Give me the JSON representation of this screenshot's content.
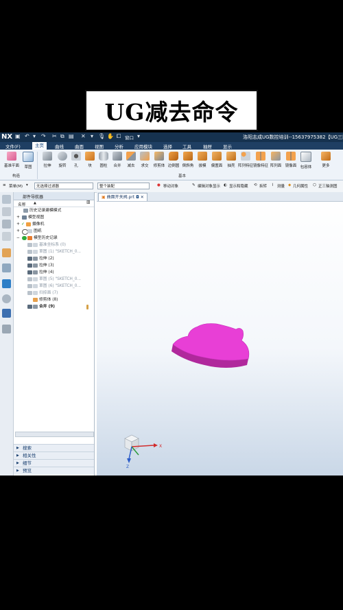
{
  "banner": {
    "title": "UG减去命令"
  },
  "titlebar": {
    "logo": "NX",
    "window_menu": "窗口",
    "title": "洛阳志成UG数控培训--15637975382【UG三四五"
  },
  "menubar": {
    "items": [
      "文件(F)",
      "主页",
      "曲线",
      "曲面",
      "视图",
      "分析",
      "应用模块",
      "选择",
      "工具",
      "抽屉",
      "显示"
    ],
    "active": "主页"
  },
  "ribbon": {
    "buttons": [
      "基准平面",
      "草图",
      "拉伸",
      "旋转",
      "孔",
      "块",
      "圆柱",
      "合并",
      "减去",
      "求交",
      "修剪体",
      "边倒圆",
      "倒斜角",
      "拔模",
      "偏置面",
      "抽壳",
      "阵列特征",
      "镜像特征",
      "阵列面",
      "镜像面",
      "包容体",
      "更多"
    ],
    "groups": [
      "构造",
      "基本"
    ]
  },
  "filterbar": {
    "menu_label": "菜单(M)",
    "filter_placeholder": "无选择过滤器",
    "scope": "整个装配",
    "tools": [
      "移动对象",
      "编辑对象显示",
      "显示和隐藏",
      "拆转",
      "测量",
      "几何属性",
      "正三轴测图"
    ]
  },
  "navigator": {
    "title": "部件导航器",
    "column_name": "名称",
    "rows": [
      {
        "label": "历史记录建模模式",
        "indent": 1,
        "dim": false
      },
      {
        "label": "模型视图",
        "indent": 0,
        "dim": false
      },
      {
        "label": "摄像机",
        "indent": 0,
        "dim": false
      },
      {
        "label": "图纸",
        "indent": 0,
        "dim": false
      },
      {
        "label": "模型历史记录",
        "indent": 0,
        "dim": false
      },
      {
        "label": "基准坐标系 (0)",
        "indent": 1,
        "dim": true
      },
      {
        "label": "草图 (1) \"SKETCH_0...",
        "indent": 1,
        "dim": true
      },
      {
        "label": "拉伸 (2)",
        "indent": 1,
        "dim": false
      },
      {
        "label": "拉伸 (3)",
        "indent": 1,
        "dim": false
      },
      {
        "label": "拉伸 (4)",
        "indent": 1,
        "dim": false
      },
      {
        "label": "草图 (5) \"SKETCH_0...",
        "indent": 1,
        "dim": true
      },
      {
        "label": "草图 (6) \"SKETCH_0...",
        "indent": 1,
        "dim": true
      },
      {
        "label": "扫掠面 (7)",
        "indent": 1,
        "dim": true
      },
      {
        "label": "修剪体 (8)",
        "indent": 1,
        "dim": false
      },
      {
        "label": "合并 (9)",
        "indent": 1,
        "dim": false
      }
    ],
    "panels": [
      "搜索",
      "相关性",
      "细节",
      "预览"
    ]
  },
  "graphics": {
    "tab_label": "曲面开关阀.prt",
    "axes": {
      "x": "X",
      "z": "Z"
    },
    "part_color": "#e83fd6"
  },
  "colors": {
    "titlebar": "#16324f",
    "menubar": "#1f3f63",
    "ribbon": "#eef3f9",
    "accent": "#1a4a80"
  }
}
